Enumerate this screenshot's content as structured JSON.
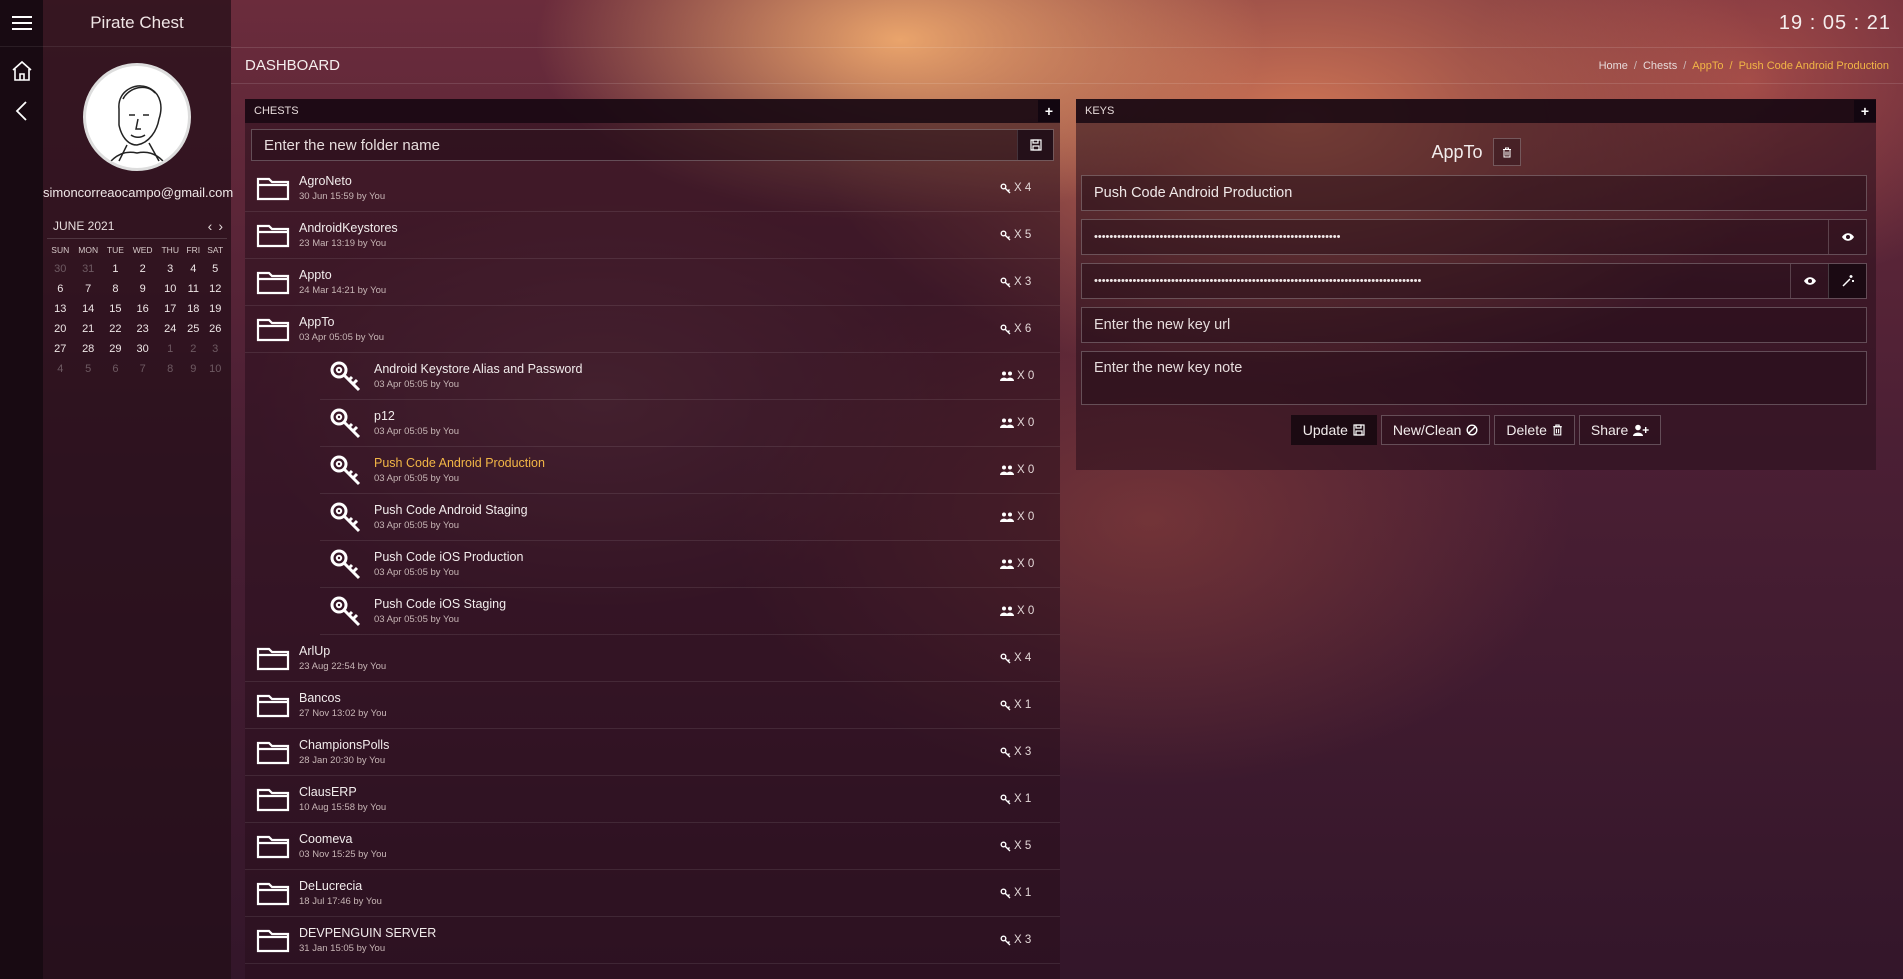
{
  "app": {
    "name": "Pirate Chest",
    "clock": "19 : 05 : 21"
  },
  "user": {
    "email": "simoncorreaocampo@gmail.com"
  },
  "calendar": {
    "month_label": "JUNE 2021",
    "days": [
      "SUN",
      "MON",
      "TUE",
      "WED",
      "THU",
      "FRI",
      "SAT"
    ],
    "weeks": [
      [
        [
          "30",
          true
        ],
        [
          "31",
          true
        ],
        [
          "1",
          false
        ],
        [
          "2",
          false
        ],
        [
          "3",
          false
        ],
        [
          "4",
          false
        ],
        [
          "5",
          false
        ]
      ],
      [
        [
          "6",
          false
        ],
        [
          "7",
          false
        ],
        [
          "8",
          false
        ],
        [
          "9",
          false
        ],
        [
          "10",
          false
        ],
        [
          "11",
          false
        ],
        [
          "12",
          false
        ]
      ],
      [
        [
          "13",
          false
        ],
        [
          "14",
          false
        ],
        [
          "15",
          false
        ],
        [
          "16",
          false
        ],
        [
          "17",
          false
        ],
        [
          "18",
          false
        ],
        [
          "19",
          false
        ]
      ],
      [
        [
          "20",
          false
        ],
        [
          "21",
          false
        ],
        [
          "22",
          false
        ],
        [
          "23",
          false
        ],
        [
          "24",
          false
        ],
        [
          "25",
          false
        ],
        [
          "26",
          false
        ]
      ],
      [
        [
          "27",
          false
        ],
        [
          "28",
          false
        ],
        [
          "29",
          false
        ],
        [
          "30",
          false
        ],
        [
          "1",
          true
        ],
        [
          "2",
          true
        ],
        [
          "3",
          true
        ]
      ],
      [
        [
          "4",
          true
        ],
        [
          "5",
          true
        ],
        [
          "6",
          true
        ],
        [
          "7",
          true
        ],
        [
          "8",
          true
        ],
        [
          "9",
          true
        ],
        [
          "10",
          true
        ]
      ]
    ]
  },
  "header": {
    "title": "DASHBOARD",
    "breadcrumbs": [
      "Home",
      "Chests",
      "AppTo",
      "Push Code Android Production"
    ]
  },
  "chests_panel": {
    "title": "CHESTS",
    "folder_placeholder": "Enter the new folder name",
    "folders_before": [
      {
        "name": "AgroNeto",
        "meta": "30 Jun 15:59 by You",
        "count": "X 4"
      },
      {
        "name": "AndroidKeystores",
        "meta": "23 Mar 13:19 by You",
        "count": "X 5"
      },
      {
        "name": "Appto",
        "meta": "24 Mar 14:21 by You",
        "count": "X 3"
      },
      {
        "name": "AppTo",
        "meta": "03 Apr 05:05 by You",
        "count": "X 6"
      }
    ],
    "keys": [
      {
        "name": "Android Keystore Alias and Password",
        "meta": "03 Apr 05:05 by You",
        "count": "X 0",
        "selected": false
      },
      {
        "name": "p12",
        "meta": "03 Apr 05:05 by You",
        "count": "X 0",
        "selected": false
      },
      {
        "name": "Push Code Android Production",
        "meta": "03 Apr 05:05 by You",
        "count": "X 0",
        "selected": true
      },
      {
        "name": "Push Code Android Staging",
        "meta": "03 Apr 05:05 by You",
        "count": "X 0",
        "selected": false
      },
      {
        "name": "Push Code iOS Production",
        "meta": "03 Apr 05:05 by You",
        "count": "X 0",
        "selected": false
      },
      {
        "name": "Push Code iOS Staging",
        "meta": "03 Apr 05:05 by You",
        "count": "X 0",
        "selected": false
      }
    ],
    "folders_after": [
      {
        "name": "ArlUp",
        "meta": "23 Aug 22:54 by You",
        "count": "X 4"
      },
      {
        "name": "Bancos",
        "meta": "27 Nov 13:02 by You",
        "count": "X 1"
      },
      {
        "name": "ChampionsPolls",
        "meta": "28 Jan 20:30 by You",
        "count": "X 3"
      },
      {
        "name": "ClausERP",
        "meta": "10 Aug 15:58 by You",
        "count": "X 1"
      },
      {
        "name": "Coomeva",
        "meta": "03 Nov 15:25 by You",
        "count": "X 5"
      },
      {
        "name": "DeLucrecia",
        "meta": "18 Jul 17:46 by You",
        "count": "X 1"
      },
      {
        "name": "DEVPENGUIN SERVER",
        "meta": "31 Jan 15:05 by You",
        "count": "X 3"
      }
    ]
  },
  "keys_panel": {
    "title": "KEYS",
    "folder_name": "AppTo",
    "key_name": "Push Code Android Production",
    "field1_masked": "••••••••••••••••••••••••••••••••••••••••••••••••••••••••••••••••",
    "field2_masked": "•••••••••••••••••••••••••••••••••••••••••••••••••••••••••••••••••••••••••••••••••••••",
    "url_placeholder": "Enter the new key url",
    "note_placeholder": "Enter the new key note",
    "buttons": {
      "update": "Update",
      "new_clean": "New/Clean",
      "delete": "Delete",
      "share": "Share"
    }
  },
  "colors": {
    "accent": "#f2b646",
    "rail": "#180a12"
  }
}
